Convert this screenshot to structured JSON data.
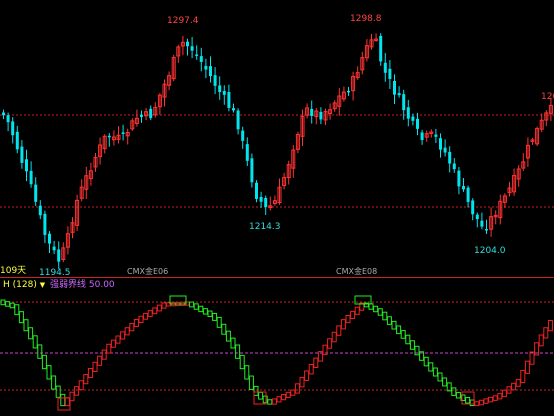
{
  "upper_panel": {
    "labels": {
      "days": "109天",
      "contract_1": "CMX金E06",
      "contract_2": "CMX金E08"
    },
    "price_annotations": [
      {
        "text": "1297.4",
        "kind": "high"
      },
      {
        "text": "1298.8",
        "kind": "high"
      },
      {
        "text": "126",
        "kind": "high"
      },
      {
        "text": "1214.3",
        "kind": "low"
      },
      {
        "text": "1194.5",
        "kind": "low"
      },
      {
        "text": "1204.0",
        "kind": "low"
      }
    ]
  },
  "lower_panel": {
    "indicator_name": "H (128)",
    "dropdown_glyph": "▼",
    "strength_line_label": "强弱界线",
    "strength_line_value": "50.00"
  },
  "colors": {
    "background": "#000000",
    "up_candle": "#ff3333",
    "down_candle": "#00e5ee",
    "osc_up": "#ee2222",
    "osc_down": "#22ee22",
    "grid_red": "#cc2222",
    "strength_line": "#cc44cc",
    "high_label": "#ff4444",
    "low_label": "#33dddd",
    "indicator_name": "#ffff44",
    "strength_label": "#cc66ff",
    "contract_label": "#aaaaaa"
  }
}
